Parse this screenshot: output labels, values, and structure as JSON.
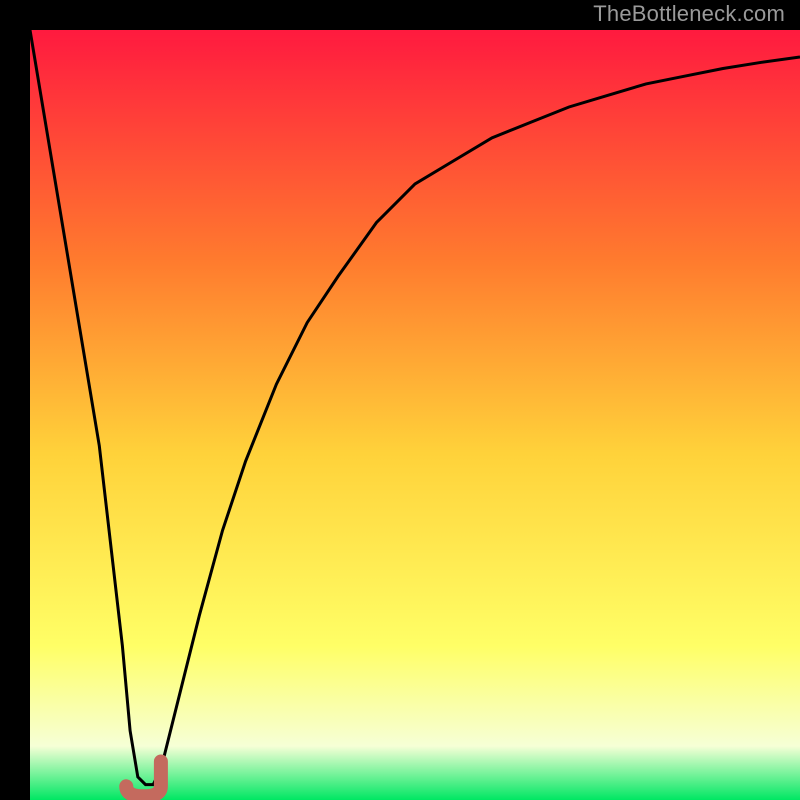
{
  "watermark": "TheBottleneck.com",
  "gradient": {
    "top": "#ff1a3f",
    "mid_upper": "#ff7b2e",
    "mid": "#ffd23a",
    "mid_lower": "#ffff66",
    "pale": "#f6ffd6",
    "bottom": "#00e763"
  },
  "curve": {
    "color": "#000000",
    "width": 3
  },
  "j_mark": {
    "color": "#c46a5e",
    "stroke_width": 14
  },
  "chart_data": {
    "type": "line",
    "title": "",
    "xlabel": "",
    "ylabel": "",
    "xlim": [
      0,
      100
    ],
    "ylim": [
      0,
      100
    ],
    "series": [
      {
        "name": "bottleneck-curve",
        "x": [
          0,
          3,
          6,
          9,
          12,
          13,
          14,
          15,
          16,
          17,
          18,
          20,
          22,
          25,
          28,
          32,
          36,
          40,
          45,
          50,
          55,
          60,
          65,
          70,
          75,
          80,
          85,
          90,
          95,
          100
        ],
        "y": [
          100,
          82,
          64,
          46,
          20,
          9,
          3,
          2,
          2,
          4,
          8,
          16,
          24,
          35,
          44,
          54,
          62,
          68,
          75,
          80,
          83,
          86,
          88,
          90,
          91.5,
          93,
          94,
          95,
          95.8,
          96.5
        ]
      }
    ],
    "marker": {
      "name": "J-marker",
      "x_range": [
        12.5,
        17
      ],
      "y_range": [
        1,
        5
      ],
      "shape": "J"
    }
  }
}
